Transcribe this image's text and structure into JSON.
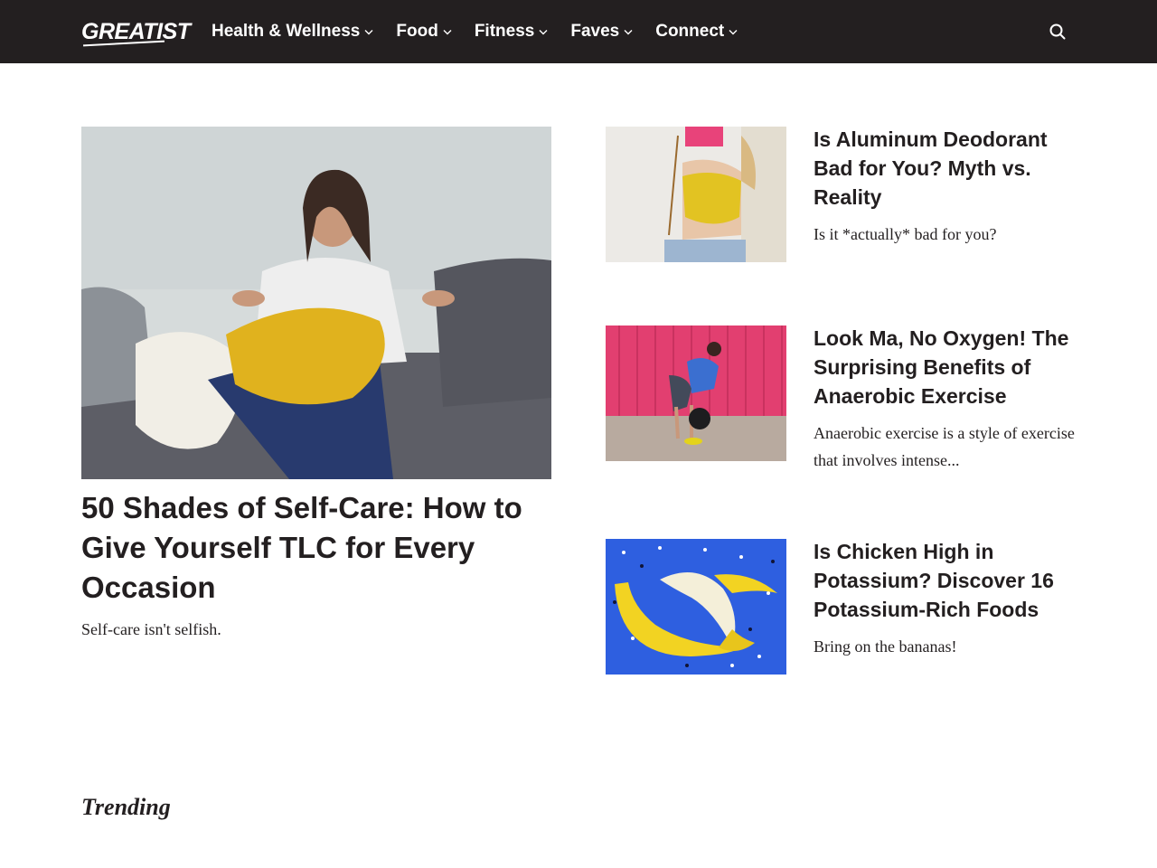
{
  "header": {
    "logo_text": "GREATIST",
    "nav": [
      {
        "label": "Health & Wellness"
      },
      {
        "label": "Food"
      },
      {
        "label": "Fitness"
      },
      {
        "label": "Faves"
      },
      {
        "label": "Connect"
      }
    ],
    "search_icon": "search-icon",
    "background": "#231f20"
  },
  "feature": {
    "title": "50 Shades of Self-Care: How to Give Yourself TLC for Every Occasion",
    "dek": "Self-care isn't selfish."
  },
  "cards": [
    {
      "title": "Is Aluminum Deodorant Bad for You? Myth vs. Reality",
      "dek": "Is it *actually* bad for you?"
    },
    {
      "title": "Look Ma, No Oxygen! The Surprising Benefits of Anaerobic Exercise",
      "dek": "Anaerobic exercise is a style of exercise that involves intense..."
    },
    {
      "title": "Is Chicken High in Potassium? Discover 16 Potassium-Rich Foods",
      "dek": "Bring on the bananas!"
    }
  ],
  "trending_label": "Trending"
}
